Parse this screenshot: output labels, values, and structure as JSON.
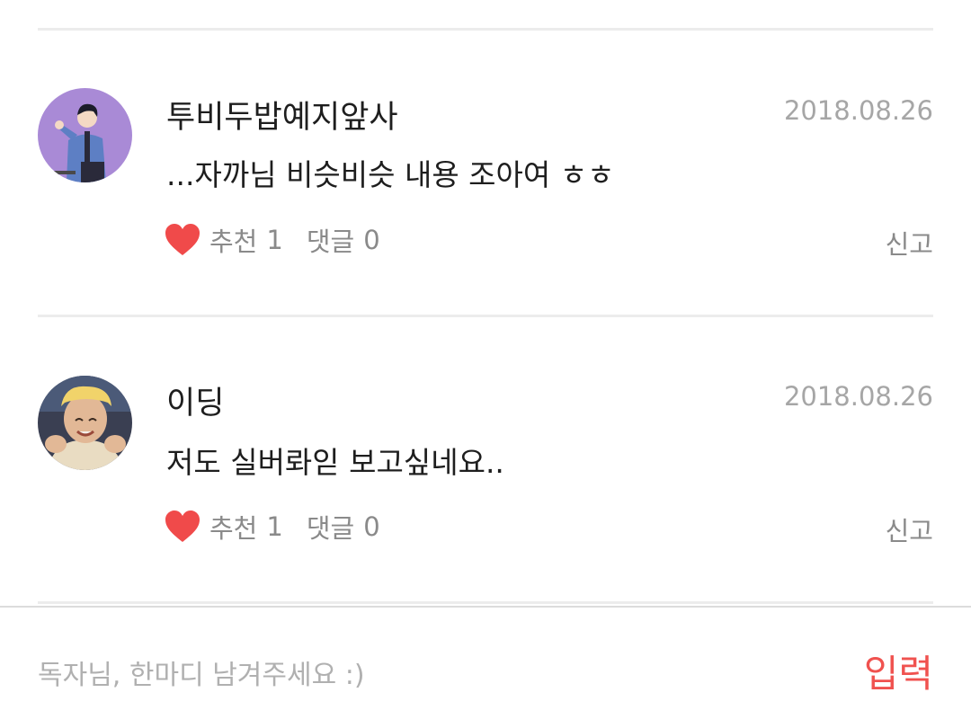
{
  "colors": {
    "heart": "#f04a4a",
    "submit": "#f0524f",
    "meta": "#8a8a8a",
    "date": "#a6a6a6",
    "placeholder": "#b0b0b0"
  },
  "comments": [
    {
      "author": "투비두밥예지앞사",
      "date": "2018.08.26",
      "text": "...자까님 비슷비슷 내용 조아여 ㅎㅎ",
      "recommend_label": "추천",
      "recommend_count": "1",
      "reply_label": "댓글",
      "reply_count": "0",
      "report_label": "신고",
      "avatar_icon": "illustrated-person-avatar"
    },
    {
      "author": "이딩",
      "date": "2018.08.26",
      "text": "저도 실버롸읻 보고싶네요..",
      "recommend_label": "추천",
      "recommend_count": "1",
      "reply_label": "댓글",
      "reply_count": "0",
      "report_label": "신고",
      "avatar_icon": "photo-person-avatar"
    }
  ],
  "input": {
    "placeholder": "독자님, 한마디 남겨주세요 :)",
    "submit_label": "입력"
  }
}
